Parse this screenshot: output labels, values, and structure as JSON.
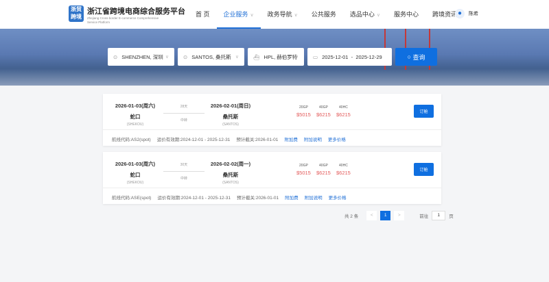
{
  "header": {
    "logo_text": "浙贸跨境",
    "title": "浙江省跨境电商综合服务平台",
    "subtitle": "Zhejiang Cross-border E-commerce Comprehensive Service Platform",
    "nav": [
      {
        "label": "首 页",
        "dropdown": false
      },
      {
        "label": "企业服务",
        "dropdown": true,
        "active": true
      },
      {
        "label": "政务导航",
        "dropdown": true
      },
      {
        "label": "公共服务",
        "dropdown": false
      },
      {
        "label": "选品中心",
        "dropdown": true
      },
      {
        "label": "服务中心",
        "dropdown": false
      },
      {
        "label": "跨境资讯",
        "dropdown": false
      }
    ],
    "user": "陈希"
  },
  "search": {
    "origin": "SHENZHEN, 深圳",
    "destination": "SANTOS, 桑托斯",
    "carrier": "HPL, 赫伯罗特",
    "date_start": "2025-12-01",
    "date_sep": "-",
    "date_end": "2025-12-29",
    "button": "查询"
  },
  "results": [
    {
      "depart_date": "2026-01-03(周六)",
      "origin": "蛇口",
      "origin_code": "(SHEKOU)",
      "days": "28天",
      "transit": "中转",
      "arrive_date": "2026-02-01(周日)",
      "dest": "桑托斯",
      "dest_code": "(SANTOS)",
      "prices": [
        {
          "type": "20GP",
          "value": "$5015"
        },
        {
          "type": "40GP",
          "value": "$6215"
        },
        {
          "type": "40HC",
          "value": "$6215"
        }
      ],
      "book": "订舱",
      "route": "航线代码:AS2(spot)",
      "validity": "运价有效期:2024-12-01 - 2025-12-31",
      "cutoff": "预计截关:2026-01-01",
      "links": [
        "附加费",
        "附加说明",
        "更多价格"
      ]
    },
    {
      "depart_date": "2026-01-03(周六)",
      "origin": "蛇口",
      "origin_code": "(SHEKOU)",
      "days": "30天",
      "transit": "中转",
      "arrive_date": "2026-02-02(周一)",
      "dest": "桑托斯",
      "dest_code": "(SANTOS)",
      "prices": [
        {
          "type": "20GP",
          "value": "$5015"
        },
        {
          "type": "40GP",
          "value": "$6215"
        },
        {
          "type": "40HC",
          "value": "$6215"
        }
      ],
      "book": "订舱",
      "route": "航线代码:ASE(spot)",
      "validity": "运价有效期:2024-12-01 - 2025-12-31",
      "cutoff": "预计截关:2026-01-01",
      "links": [
        "附加费",
        "附加说明",
        "更多价格"
      ]
    }
  ],
  "pagination": {
    "total": "共 2 条",
    "prev": "<",
    "current": "1",
    "next": ">",
    "goto_label": "前往",
    "goto_value": "1",
    "page_suffix": "页"
  },
  "colors": {
    "primary": "#0f6fe0",
    "price": "#e35a5a"
  }
}
